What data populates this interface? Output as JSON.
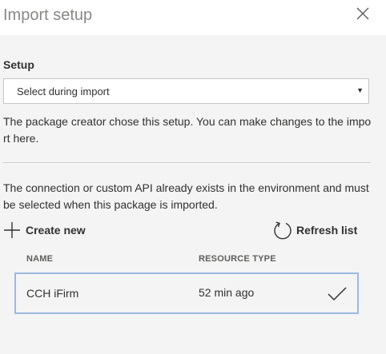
{
  "panel": {
    "title": "Import setup",
    "close_icon": "close-icon"
  },
  "setup": {
    "label": "Setup",
    "select_value": "Select during import",
    "helptext": "The package creator chose this setup. You can make changes to the import here."
  },
  "connection": {
    "description": "The connection or custom API already exists in the environment and must be selected when this package is imported.",
    "create_new_label": "Create new",
    "create_new_icon": "plus-icon",
    "refresh_label": "Refresh list",
    "refresh_icon": "refresh-icon"
  },
  "table": {
    "columns": [
      "NAME",
      "RESOURCE TYPE"
    ],
    "rows": [
      {
        "name": "CCH iFirm",
        "resource_type": "52 min ago",
        "selected": true
      }
    ]
  },
  "colors": {
    "background": "#f4f4f4",
    "header_background": "#ffffff",
    "selected_row_border": "#9bb9e0",
    "text": "#323130",
    "muted_title": "#8a8886"
  }
}
